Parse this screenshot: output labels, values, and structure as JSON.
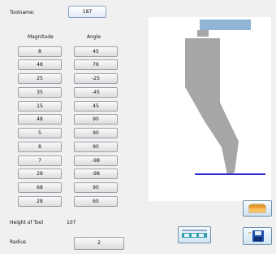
{
  "tool": {
    "name_label": "Toolname:",
    "name_value": "187"
  },
  "table": {
    "headers": {
      "magnitude": "Magnitude",
      "angle": "Angle"
    },
    "rows": [
      {
        "magnitude": "8",
        "angle": "45"
      },
      {
        "magnitude": "48",
        "angle": "76"
      },
      {
        "magnitude": "25",
        "angle": "-25"
      },
      {
        "magnitude": "35",
        "angle": "-45"
      },
      {
        "magnitude": "15",
        "angle": "45"
      },
      {
        "magnitude": "48",
        "angle": "90"
      },
      {
        "magnitude": "5",
        "angle": "90"
      },
      {
        "magnitude": "8",
        "angle": "90"
      },
      {
        "magnitude": "7",
        "angle": "-98"
      },
      {
        "magnitude": "28",
        "angle": "-98"
      },
      {
        "magnitude": "68",
        "angle": "90"
      },
      {
        "magnitude": "28",
        "angle": "60"
      }
    ]
  },
  "height": {
    "label": "Height of Tool",
    "value": "107"
  },
  "radius": {
    "label": "Radius",
    "value": "2"
  },
  "colors": {
    "tool_fill": "#a6a6a6",
    "holder": "#8fb4d6",
    "baseline": "#2b2bd6"
  },
  "icons": {
    "open": "folder-open-icon",
    "middle": "toolbar-icon",
    "save": "floppy-save-icon"
  }
}
